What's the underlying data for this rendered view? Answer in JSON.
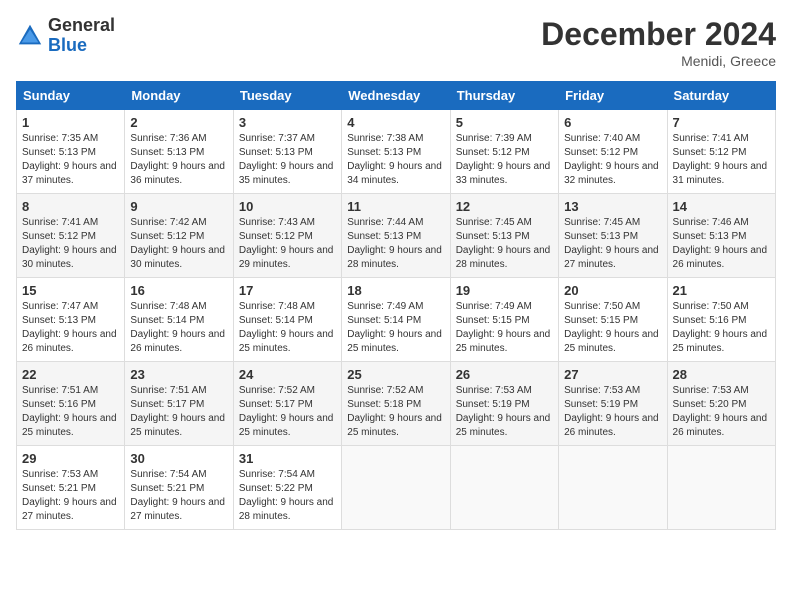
{
  "header": {
    "logo_general": "General",
    "logo_blue": "Blue",
    "month_title": "December 2024",
    "location": "Menidi, Greece"
  },
  "weekdays": [
    "Sunday",
    "Monday",
    "Tuesday",
    "Wednesday",
    "Thursday",
    "Friday",
    "Saturday"
  ],
  "weeks": [
    [
      {
        "day": "1",
        "sunrise": "Sunrise: 7:35 AM",
        "sunset": "Sunset: 5:13 PM",
        "daylight": "Daylight: 9 hours and 37 minutes."
      },
      {
        "day": "2",
        "sunrise": "Sunrise: 7:36 AM",
        "sunset": "Sunset: 5:13 PM",
        "daylight": "Daylight: 9 hours and 36 minutes."
      },
      {
        "day": "3",
        "sunrise": "Sunrise: 7:37 AM",
        "sunset": "Sunset: 5:13 PM",
        "daylight": "Daylight: 9 hours and 35 minutes."
      },
      {
        "day": "4",
        "sunrise": "Sunrise: 7:38 AM",
        "sunset": "Sunset: 5:13 PM",
        "daylight": "Daylight: 9 hours and 34 minutes."
      },
      {
        "day": "5",
        "sunrise": "Sunrise: 7:39 AM",
        "sunset": "Sunset: 5:12 PM",
        "daylight": "Daylight: 9 hours and 33 minutes."
      },
      {
        "day": "6",
        "sunrise": "Sunrise: 7:40 AM",
        "sunset": "Sunset: 5:12 PM",
        "daylight": "Daylight: 9 hours and 32 minutes."
      },
      {
        "day": "7",
        "sunrise": "Sunrise: 7:41 AM",
        "sunset": "Sunset: 5:12 PM",
        "daylight": "Daylight: 9 hours and 31 minutes."
      }
    ],
    [
      {
        "day": "8",
        "sunrise": "Sunrise: 7:41 AM",
        "sunset": "Sunset: 5:12 PM",
        "daylight": "Daylight: 9 hours and 30 minutes."
      },
      {
        "day": "9",
        "sunrise": "Sunrise: 7:42 AM",
        "sunset": "Sunset: 5:12 PM",
        "daylight": "Daylight: 9 hours and 30 minutes."
      },
      {
        "day": "10",
        "sunrise": "Sunrise: 7:43 AM",
        "sunset": "Sunset: 5:12 PM",
        "daylight": "Daylight: 9 hours and 29 minutes."
      },
      {
        "day": "11",
        "sunrise": "Sunrise: 7:44 AM",
        "sunset": "Sunset: 5:13 PM",
        "daylight": "Daylight: 9 hours and 28 minutes."
      },
      {
        "day": "12",
        "sunrise": "Sunrise: 7:45 AM",
        "sunset": "Sunset: 5:13 PM",
        "daylight": "Daylight: 9 hours and 28 minutes."
      },
      {
        "day": "13",
        "sunrise": "Sunrise: 7:45 AM",
        "sunset": "Sunset: 5:13 PM",
        "daylight": "Daylight: 9 hours and 27 minutes."
      },
      {
        "day": "14",
        "sunrise": "Sunrise: 7:46 AM",
        "sunset": "Sunset: 5:13 PM",
        "daylight": "Daylight: 9 hours and 26 minutes."
      }
    ],
    [
      {
        "day": "15",
        "sunrise": "Sunrise: 7:47 AM",
        "sunset": "Sunset: 5:13 PM",
        "daylight": "Daylight: 9 hours and 26 minutes."
      },
      {
        "day": "16",
        "sunrise": "Sunrise: 7:48 AM",
        "sunset": "Sunset: 5:14 PM",
        "daylight": "Daylight: 9 hours and 26 minutes."
      },
      {
        "day": "17",
        "sunrise": "Sunrise: 7:48 AM",
        "sunset": "Sunset: 5:14 PM",
        "daylight": "Daylight: 9 hours and 25 minutes."
      },
      {
        "day": "18",
        "sunrise": "Sunrise: 7:49 AM",
        "sunset": "Sunset: 5:14 PM",
        "daylight": "Daylight: 9 hours and 25 minutes."
      },
      {
        "day": "19",
        "sunrise": "Sunrise: 7:49 AM",
        "sunset": "Sunset: 5:15 PM",
        "daylight": "Daylight: 9 hours and 25 minutes."
      },
      {
        "day": "20",
        "sunrise": "Sunrise: 7:50 AM",
        "sunset": "Sunset: 5:15 PM",
        "daylight": "Daylight: 9 hours and 25 minutes."
      },
      {
        "day": "21",
        "sunrise": "Sunrise: 7:50 AM",
        "sunset": "Sunset: 5:16 PM",
        "daylight": "Daylight: 9 hours and 25 minutes."
      }
    ],
    [
      {
        "day": "22",
        "sunrise": "Sunrise: 7:51 AM",
        "sunset": "Sunset: 5:16 PM",
        "daylight": "Daylight: 9 hours and 25 minutes."
      },
      {
        "day": "23",
        "sunrise": "Sunrise: 7:51 AM",
        "sunset": "Sunset: 5:17 PM",
        "daylight": "Daylight: 9 hours and 25 minutes."
      },
      {
        "day": "24",
        "sunrise": "Sunrise: 7:52 AM",
        "sunset": "Sunset: 5:17 PM",
        "daylight": "Daylight: 9 hours and 25 minutes."
      },
      {
        "day": "25",
        "sunrise": "Sunrise: 7:52 AM",
        "sunset": "Sunset: 5:18 PM",
        "daylight": "Daylight: 9 hours and 25 minutes."
      },
      {
        "day": "26",
        "sunrise": "Sunrise: 7:53 AM",
        "sunset": "Sunset: 5:19 PM",
        "daylight": "Daylight: 9 hours and 25 minutes."
      },
      {
        "day": "27",
        "sunrise": "Sunrise: 7:53 AM",
        "sunset": "Sunset: 5:19 PM",
        "daylight": "Daylight: 9 hours and 26 minutes."
      },
      {
        "day": "28",
        "sunrise": "Sunrise: 7:53 AM",
        "sunset": "Sunset: 5:20 PM",
        "daylight": "Daylight: 9 hours and 26 minutes."
      }
    ],
    [
      {
        "day": "29",
        "sunrise": "Sunrise: 7:53 AM",
        "sunset": "Sunset: 5:21 PM",
        "daylight": "Daylight: 9 hours and 27 minutes."
      },
      {
        "day": "30",
        "sunrise": "Sunrise: 7:54 AM",
        "sunset": "Sunset: 5:21 PM",
        "daylight": "Daylight: 9 hours and 27 minutes."
      },
      {
        "day": "31",
        "sunrise": "Sunrise: 7:54 AM",
        "sunset": "Sunset: 5:22 PM",
        "daylight": "Daylight: 9 hours and 28 minutes."
      },
      null,
      null,
      null,
      null
    ]
  ]
}
